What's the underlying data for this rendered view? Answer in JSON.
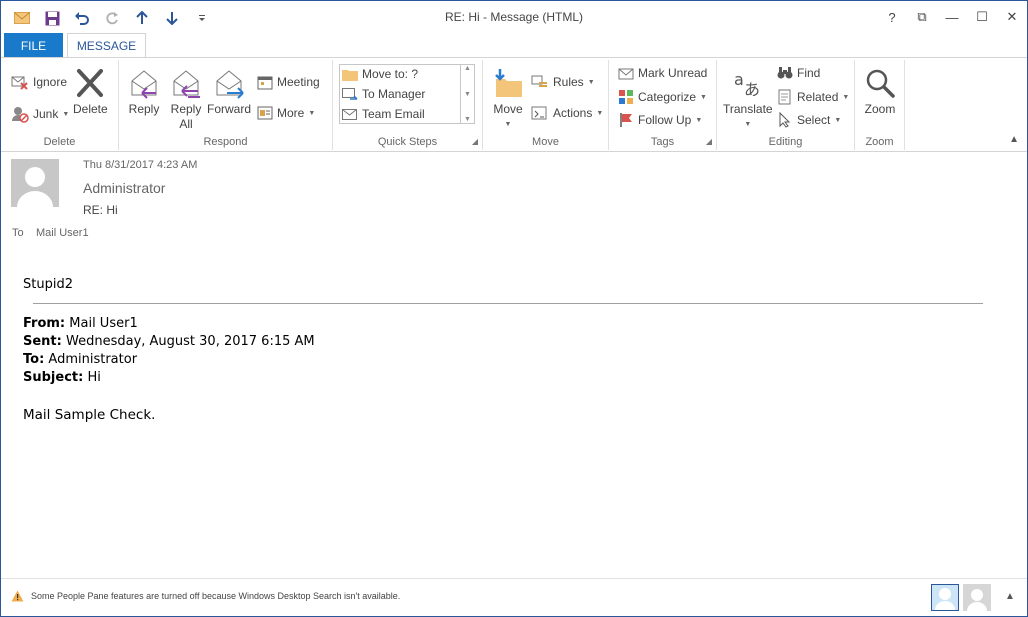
{
  "window": {
    "title": "RE: Hi - Message (HTML)",
    "controls": {
      "help": "?",
      "restore_ribbon": "⧉",
      "minimize": "—",
      "maximize": "☐",
      "close": "✕"
    }
  },
  "tabs": {
    "file": "FILE",
    "message": "MESSAGE"
  },
  "ribbon": {
    "delete_group": {
      "label": "Delete",
      "ignore": "Ignore",
      "junk": "Junk",
      "delete": "Delete"
    },
    "respond_group": {
      "label": "Respond",
      "reply": "Reply",
      "reply_all_1": "Reply",
      "reply_all_2": "All",
      "forward": "Forward",
      "meeting": "Meeting",
      "more": "More"
    },
    "quick_steps_group": {
      "label": "Quick Steps",
      "items": [
        "Move to: ?",
        "To Manager",
        "Team Email"
      ]
    },
    "move_group": {
      "label": "Move",
      "move": "Move",
      "rules": "Rules",
      "actions": "Actions"
    },
    "tags_group": {
      "label": "Tags",
      "mark_unread": "Mark Unread",
      "categorize": "Categorize",
      "follow_up": "Follow Up"
    },
    "editing_group": {
      "label": "Editing",
      "translate": "Translate",
      "find": "Find",
      "related": "Related",
      "select": "Select"
    },
    "zoom_group": {
      "label": "Zoom",
      "zoom": "Zoom"
    }
  },
  "header": {
    "date": "Thu 8/31/2017 4:23 AM",
    "sender": "Administrator",
    "subject": "RE: Hi",
    "to_label": "To",
    "to_value": "Mail User1"
  },
  "body": {
    "greeting": "Stupid2",
    "from_label": "From:",
    "from_value": " Mail User1",
    "sent_label": "Sent:",
    "sent_value": " Wednesday, August 30, 2017 6:15 AM",
    "to_label": "To:",
    "to_value": " Administrator",
    "subject_label": "Subject:",
    "subject_value": " Hi",
    "closing": "Mail Sample Check."
  },
  "status": {
    "message": "Some People Pane features are turned off because Windows Desktop Search isn't available."
  },
  "colors": {
    "accent": "#2b579a",
    "file_tab": "#1979ca"
  }
}
